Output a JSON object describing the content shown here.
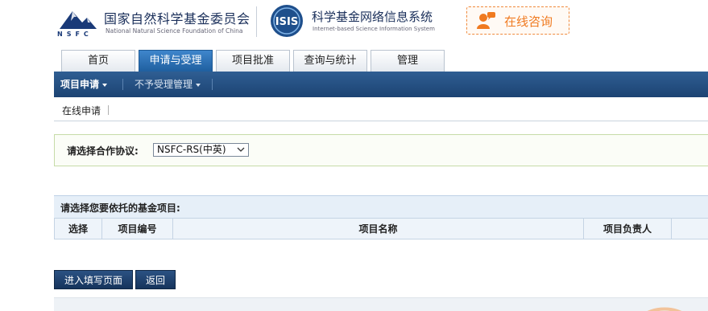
{
  "header": {
    "org_name": "国家自然科学基金委员会",
    "org_subtitle": "National Natural Science Foundation of China",
    "org_logo_text": "NSFC",
    "system_logo_text": "ISIS",
    "system_name": "科学基金网络信息系统",
    "system_subtitle": "Internet-based Science Information System",
    "consult_label": "在线咨询",
    "consult_icon": "chat-person-icon"
  },
  "tabs": [
    {
      "label": "首页",
      "active": false
    },
    {
      "label": "申请与受理",
      "active": true
    },
    {
      "label": "项目批准",
      "active": false
    },
    {
      "label": "查询与统计",
      "active": false
    },
    {
      "label": "管理",
      "active": false
    }
  ],
  "navbar": {
    "items": [
      {
        "label": "项目申请",
        "active": true
      },
      {
        "label": "不予受理管理",
        "active": false
      }
    ]
  },
  "subnav": {
    "items": [
      {
        "label": "在线申请"
      }
    ]
  },
  "protocol": {
    "label": "请选择合作协议:",
    "selected": "NSFC-RS(中英)"
  },
  "project_table": {
    "title": "请选择您要依托的基金项目:",
    "columns": [
      "选择",
      "项目编号",
      "项目名称",
      "项目负责人"
    ]
  },
  "buttons": {
    "enter_label": "进入填写页面",
    "back_label": "返回"
  },
  "colors": {
    "accent_blue": "#1f5f9f",
    "navbar_blue": "#1c4373",
    "consult_orange": "#f07a20",
    "protocol_border_green": "#c6dca8"
  }
}
